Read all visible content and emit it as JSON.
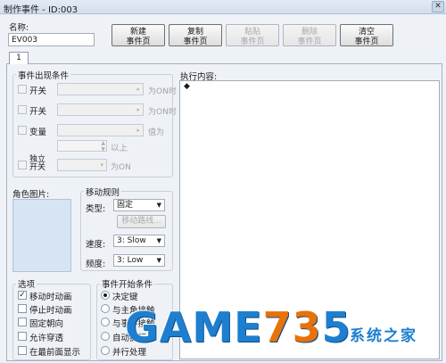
{
  "window": {
    "title": "制作事件 - ID:003",
    "close_glyph": "✕"
  },
  "name": {
    "label": "名称:",
    "value": "EV003"
  },
  "toolbar": [
    {
      "line1": "新建",
      "line2": "事件页",
      "enabled": true
    },
    {
      "line1": "复制",
      "line2": "事件页",
      "enabled": true
    },
    {
      "line1": "粘贴",
      "line2": "事件页",
      "enabled": false
    },
    {
      "line1": "删除",
      "line2": "事件页",
      "enabled": false
    },
    {
      "line1": "清空",
      "line2": "事件页",
      "enabled": true
    }
  ],
  "tab": {
    "label": "1"
  },
  "conditions": {
    "title": "事件出现条件",
    "switch1": {
      "label": "开关",
      "suffix": "为ON时"
    },
    "switch2": {
      "label": "开关",
      "suffix": "为ON时"
    },
    "variable": {
      "label": "变量",
      "suffix": "值为",
      "above": "以上"
    },
    "self_switch": {
      "label_line1": "独立",
      "label_line2": "开关",
      "suffix": "为ON"
    }
  },
  "execution": {
    "label": "执行内容:",
    "first_line": "◆"
  },
  "graphic": {
    "label": "角色图片:"
  },
  "movement": {
    "title": "移动规则",
    "type_label": "类型:",
    "type_value": "固定",
    "route_button": "移动路线...",
    "speed_label": "速度:",
    "speed_value": "3: Slow",
    "freq_label": "频度:",
    "freq_value": "3: Low"
  },
  "options": {
    "title": "选项",
    "items": [
      {
        "label": "移动时动画",
        "checked": true
      },
      {
        "label": "停止时动画",
        "checked": false
      },
      {
        "label": "固定朝向",
        "checked": false
      },
      {
        "label": "允许穿透",
        "checked": false
      },
      {
        "label": "在最前面显示",
        "checked": false
      }
    ]
  },
  "trigger": {
    "title": "事件开始条件",
    "items": [
      {
        "label": "决定键",
        "selected": true
      },
      {
        "label": "与主角接触",
        "selected": false
      },
      {
        "label": "与事件接触",
        "selected": false
      },
      {
        "label": "自动执行",
        "selected": false
      },
      {
        "label": "并行处理",
        "selected": false
      }
    ]
  },
  "watermark": {
    "main_a": "GAME",
    "main_b": "73",
    "main_c": "5",
    "sub": "系统之家"
  },
  "colors": {
    "accent": "#1e7fd0",
    "watermark_orange": "#e8720a",
    "graphic_bg": "#d6e4f3"
  }
}
